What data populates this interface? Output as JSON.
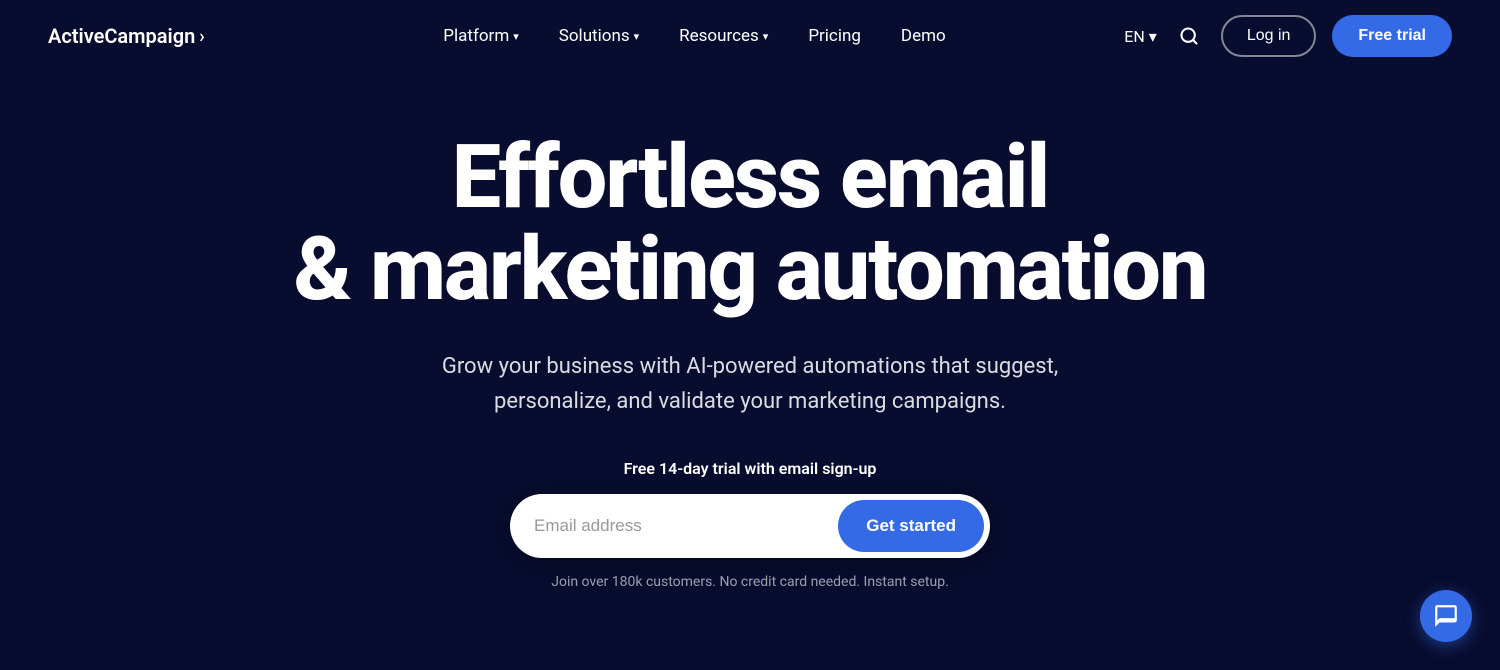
{
  "brand": {
    "logo_text": "ActiveCampaign",
    "logo_arrow": "›"
  },
  "nav": {
    "links": [
      {
        "label": "Platform",
        "has_dropdown": true
      },
      {
        "label": "Solutions",
        "has_dropdown": true
      },
      {
        "label": "Resources",
        "has_dropdown": true
      },
      {
        "label": "Pricing",
        "has_dropdown": false
      },
      {
        "label": "Demo",
        "has_dropdown": false
      }
    ],
    "lang": "EN",
    "login_label": "Log in",
    "free_trial_label": "Free trial"
  },
  "hero": {
    "title_line1": "Effortless email",
    "title_line2": "& marketing automation",
    "subtitle": "Grow your business with AI-powered automations that suggest, personalize, and validate your marketing campaigns.",
    "trial_label": "Free 14-day trial with email sign-up",
    "email_placeholder": "Email address",
    "cta_label": "Get started",
    "note": "Join over 180k customers. No credit card needed. Instant setup."
  }
}
